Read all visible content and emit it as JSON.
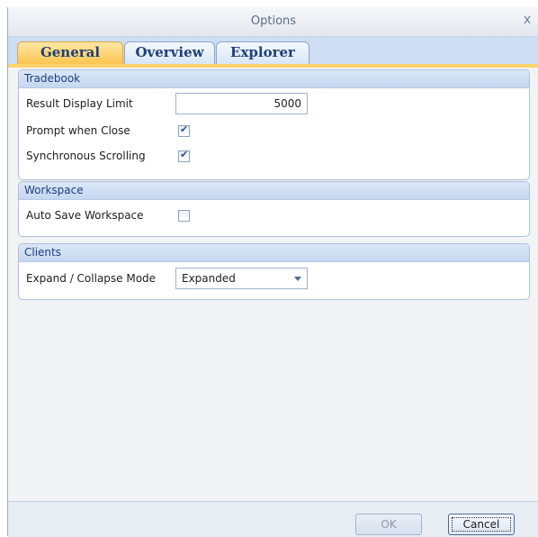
{
  "window": {
    "title": "Options",
    "close_glyph": "x"
  },
  "tabs": [
    {
      "label": "General",
      "active": true
    },
    {
      "label": "Overview",
      "active": false
    },
    {
      "label": "Explorer",
      "active": false
    }
  ],
  "tradebook": {
    "header": "Tradebook",
    "result_display_limit": {
      "label": "Result Display Limit",
      "value": "5000"
    },
    "prompt_when_close": {
      "label": "Prompt when Close",
      "checked": true
    },
    "synchronous_scrolling": {
      "label": "Synchronous Scrolling",
      "checked": true
    }
  },
  "workspace": {
    "header": "Workspace",
    "auto_save_workspace": {
      "label": "Auto Save Workspace",
      "checked": false
    }
  },
  "clients": {
    "header": "Clients",
    "expand_collapse_mode": {
      "label": "Expand / Collapse Mode",
      "value": "Expanded"
    }
  },
  "footer": {
    "ok_label": "OK",
    "cancel_label": "Cancel"
  },
  "colors": {
    "accent_tab": "#ffc550",
    "tabstrip": "#cdddf3",
    "group_header": "#c5d7f0",
    "text_blue": "#1f3f7a"
  },
  "icons": {
    "close": "close-icon",
    "check": "checkmark-icon",
    "dropdown": "chevron-down-icon"
  }
}
